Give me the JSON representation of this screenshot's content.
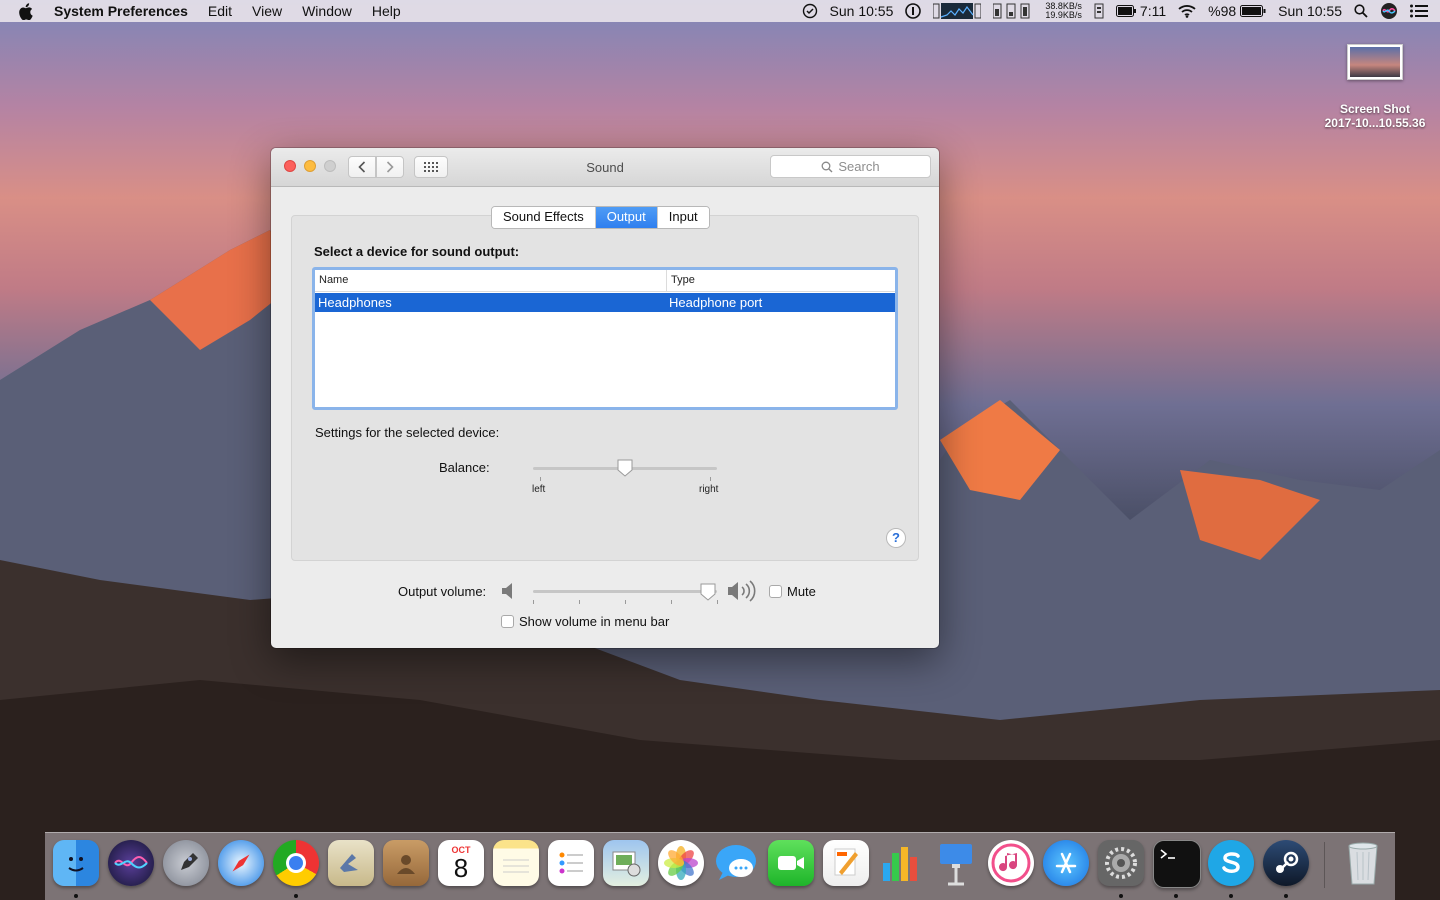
{
  "menubar": {
    "app_name": "System Preferences",
    "menus": [
      "Edit",
      "View",
      "Window",
      "Help"
    ],
    "clock_left": "Sun 10:55",
    "net_up": "38.8KB/s",
    "net_down": "19.9KB/s",
    "battery_time": "7:11",
    "battery_pct": "%98",
    "clock_right": "Sun 10:55"
  },
  "desktop": {
    "file_line1": "Screen Shot",
    "file_line2": "2017-10...10.55.36"
  },
  "window": {
    "title": "Sound",
    "search_placeholder": "Search",
    "tabs": [
      {
        "label": "Sound Effects",
        "active": false
      },
      {
        "label": "Output",
        "active": true
      },
      {
        "label": "Input",
        "active": false
      }
    ],
    "output": {
      "section_title": "Select a device for sound output:",
      "columns": [
        "Name",
        "Type"
      ],
      "rows": [
        {
          "name": "Headphones",
          "type": "Headphone port",
          "selected": true
        }
      ],
      "settings_label": "Settings for the selected device:",
      "balance_label": "Balance:",
      "balance_left": "left",
      "balance_right": "right",
      "balance_value": 0.5,
      "help_label": "?"
    },
    "volume_label": "Output volume:",
    "volume_value": 0.95,
    "mute_label": "Mute",
    "mute_checked": false,
    "show_volume_label": "Show volume in menu bar",
    "show_volume_checked": false
  },
  "dock": {
    "apps": [
      "finder-icon",
      "siri-icon",
      "launchpad-icon",
      "safari-icon",
      "chrome-icon",
      "mail-icon",
      "contacts-icon",
      "calendar-icon",
      "notes-icon",
      "reminders-icon",
      "preview-icon",
      "photos-icon",
      "messages-icon",
      "facetime-icon",
      "pages-icon",
      "numbers-icon",
      "keynote-icon",
      "itunes-icon",
      "app-store-icon",
      "system-preferences-icon",
      "terminal-icon",
      "skype-icon",
      "steam-icon",
      "trash-icon"
    ],
    "calendar_month": "OCT",
    "calendar_day": "8"
  },
  "colors": {
    "accent": "#2f7fef",
    "selection": "#1a66d4",
    "close": "#fc605c",
    "minimize": "#fdbc40"
  }
}
